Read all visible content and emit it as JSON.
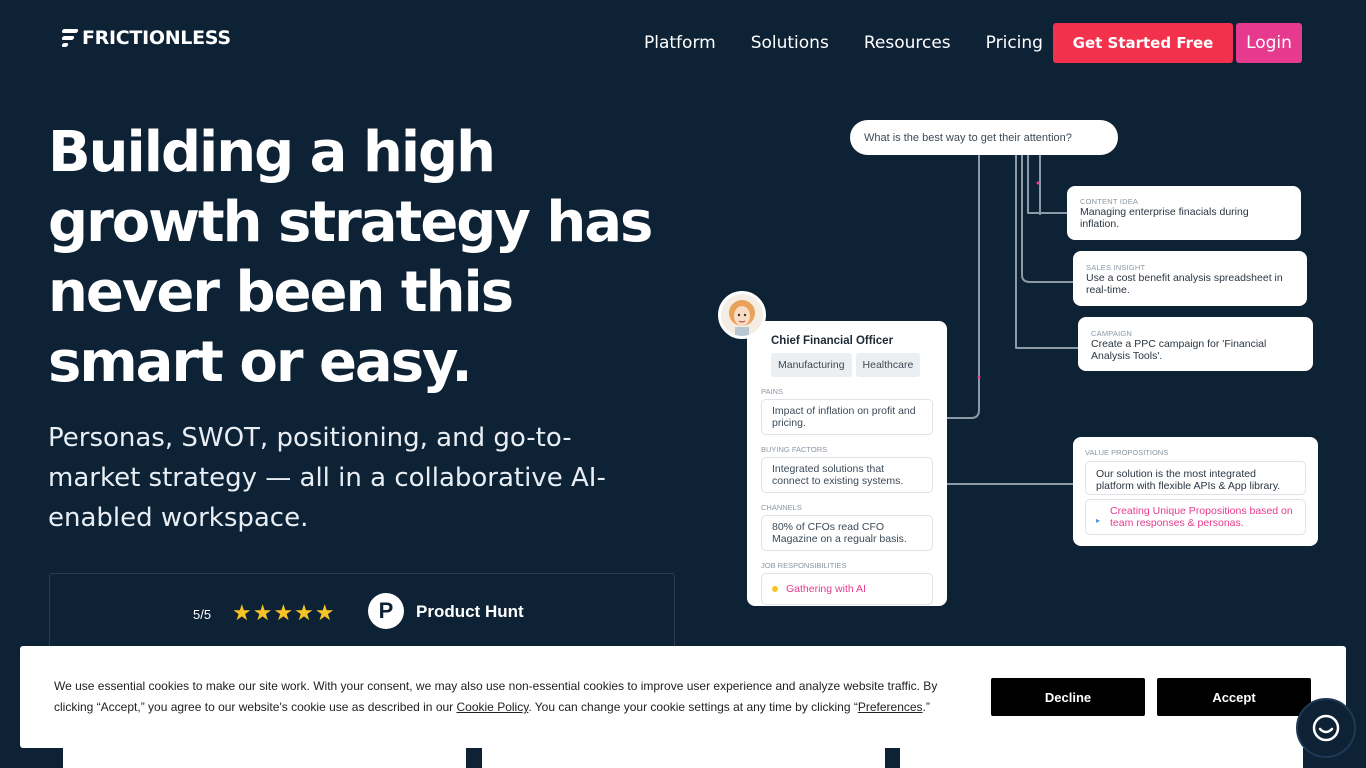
{
  "brand": {
    "name": "FRICTIONLESS"
  },
  "nav": {
    "items": [
      "Platform",
      "Solutions",
      "Resources",
      "Pricing"
    ],
    "cta_label": "Get Started Free",
    "login_label": "Login"
  },
  "hero": {
    "title": "Building a high growth strategy has never been this smart or easy.",
    "subtitle": "Personas, SWOT, positioning, and go-to-market strategy — all in a collaborative AI-enabled workspace."
  },
  "rating": {
    "score": "5/5",
    "stars": "★★★★★",
    "badge_letter": "P",
    "source": "Product Hunt"
  },
  "illustration": {
    "question": "What is the best way to get their attention?",
    "content_idea": {
      "kicker": "CONTENT IDEA",
      "text": "Managing enterprise finacials during inflation."
    },
    "sales_insight": {
      "kicker": "SALES INSIGHT",
      "text": "Use a cost benefit analysis spreadsheet in real-time."
    },
    "campaign": {
      "kicker": "CAMPAIGN",
      "text": "Create a PPC campaign for 'Financial Analysis Tools'."
    },
    "persona": {
      "title": "Chief Financial Officer",
      "tags": [
        "Manufacturing",
        "Healthcare"
      ],
      "pains_label": "PAINS",
      "pains": "Impact of inflation on profit and pricing.",
      "buying_label": "BUYING FACTORS",
      "buying": "Integrated solutions that connect to existing systems.",
      "channels_label": "CHANNELS",
      "channels": "80% of CFOs read CFO Magazine on a regualr basis.",
      "job_label": "JOB RESPONSIBILITIES",
      "job": "Gathering with AI"
    },
    "value_props": {
      "label": "VALUE PROPOSITIONS",
      "text": "Our solution is the most integrated platform with flexible APIs & App library.",
      "creating": "Creating Unique Propositions based on team responses & personas."
    }
  },
  "cookie": {
    "text_1": "We use essential cookies to make our site work. With your consent, we may also use non-essential cookies to improve user experience and analyze website traffic. By clicking “Accept,” you agree to our website's cookie use as described in our ",
    "policy_link": "Cookie Policy",
    "text_2": ". You can change your cookie settings at any time by clicking “",
    "prefs_link": "Preferences",
    "text_3": ".”",
    "decline_label": "Decline",
    "accept_label": "Accept"
  },
  "colors": {
    "background": "#0e2236",
    "cta": "#f2314d",
    "login": "#e63a8e",
    "star": "#f7c325"
  }
}
